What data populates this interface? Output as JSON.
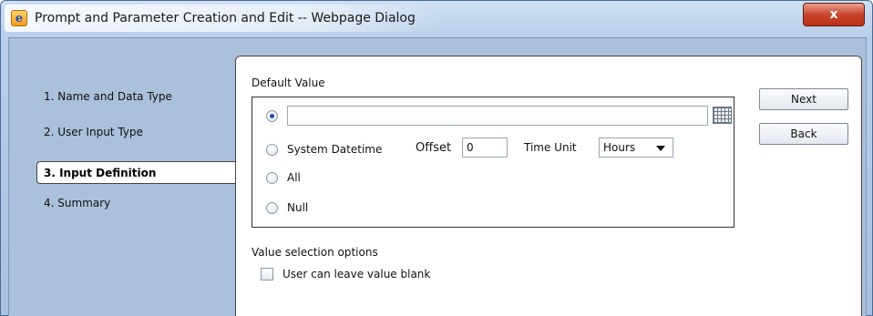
{
  "window": {
    "title": "Prompt and Parameter Creation and Edit -- Webpage Dialog",
    "close_label": "x",
    "app_icon": "internet-explorer-icon"
  },
  "steps": [
    {
      "label": "1. Name and Data Type"
    },
    {
      "label": "2. User Input Type"
    },
    {
      "label": "3. Input Definition",
      "active": true
    },
    {
      "label": "4. Summary"
    }
  ],
  "default_value": {
    "heading": "Default Value",
    "value_input": "",
    "picker_icon": "grid-picker-icon",
    "options": {
      "value_selected": true,
      "system_datetime_label": "System Datetime",
      "all_label": "All",
      "null_label": "Null"
    },
    "offset_label": "Offset",
    "offset_value": "0",
    "time_unit_label": "Time Unit",
    "time_unit_value": "Hours"
  },
  "value_selection": {
    "heading": "Value selection options",
    "blank_label": "User can leave value blank",
    "blank_checked": false
  },
  "buttons": {
    "next": "Next",
    "back": "Back"
  }
}
